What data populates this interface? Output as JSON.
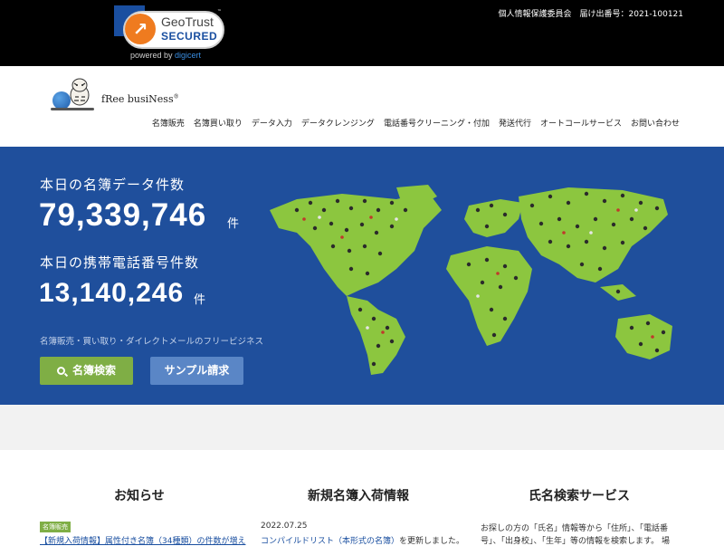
{
  "top_bar": {
    "seal": {
      "brand": "GeoTrust",
      "status": "SECURED",
      "trademark": "™",
      "powered_by": "powered by",
      "powered_brand": "digicert"
    },
    "registration": "個人情報保護委員会　届け出番号：2021-100121"
  },
  "header": {
    "logo_text": "fRee busiNess",
    "logo_mark": "®",
    "nav": [
      "名簿販売",
      "名簿買い取り",
      "データ入力",
      "データクレンジング",
      "電話番号クリーニング・付加",
      "発送代行",
      "オートコールサービス",
      "お問い合わせ"
    ]
  },
  "hero": {
    "label_records": "本日の名簿データ件数",
    "count_records": "79,339,746",
    "unit_records": "件",
    "label_mobile": "本日の携帯電話番号件数",
    "count_mobile": "13,140,246",
    "unit_mobile": "件",
    "tagline": "名簿販売・買い取り・ダイレクトメールのフリービジネス",
    "search_button": "名簿検索",
    "sample_button": "サンプル請求",
    "map_icon": "world-map-people"
  },
  "sections": {
    "news": {
      "title": "お知らせ",
      "tag": "名簿販売",
      "item": "【新規入荷情報】属性付き名簿（34種類）の件数が増え"
    },
    "arrivals": {
      "title": "新規名簿入荷情報",
      "date": "2022.07.25",
      "link_text": "コンパイルドリスト（本形式の名簿）",
      "suffix": "を更新しました。"
    },
    "name_search": {
      "title": "氏名検索サービス",
      "line1": "お探しの方の「氏名」情報等から「住所」、「電話番",
      "line2": "号」、「出身校」、「生年」等の情報を検索します。 場"
    }
  },
  "colors": {
    "hero_bg": "#1f4f9c",
    "search_btn": "#7fae45",
    "sample_btn": "#5a86c6",
    "map_land": "#8cc63f"
  }
}
